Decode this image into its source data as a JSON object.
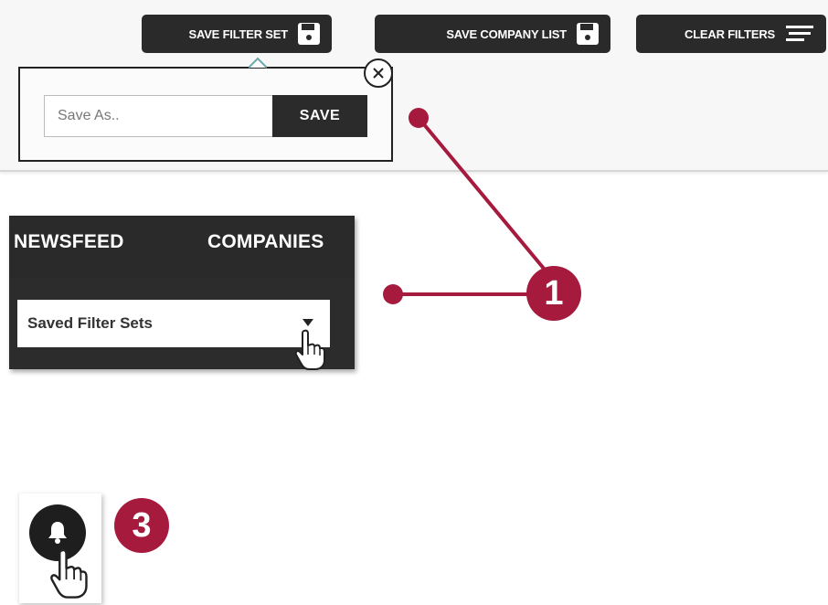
{
  "toolbar": {
    "save_filter_set": "SAVE FILTER SET",
    "save_company_list": "SAVE COMPANY LIST",
    "clear_filters": "CLEAR FILTERS"
  },
  "popover": {
    "input_placeholder": "Save As..",
    "save_button": "SAVE"
  },
  "nav": {
    "tabs": [
      "NEWSFEED",
      "COMPANIES"
    ],
    "dropdown_selected": "Saved Filter Sets"
  },
  "callouts": {
    "badge_1": "1",
    "badge_3": "3",
    "color": "#a61a3e"
  },
  "icons": {
    "floppy": "floppy-disk-icon",
    "lines": "filter-lines-icon",
    "close": "close-icon",
    "arrow": "dropdown-arrow-icon",
    "hand": "hand-cursor-icon",
    "bell": "bell-icon"
  }
}
